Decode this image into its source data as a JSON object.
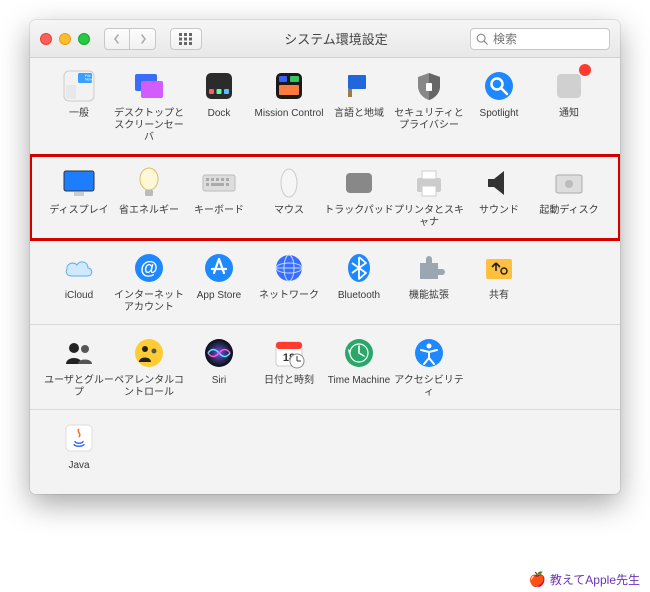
{
  "window": {
    "title": "システム環境設定"
  },
  "search": {
    "placeholder": "検索"
  },
  "rows": [
    {
      "items": [
        {
          "key": "general",
          "label": "一般"
        },
        {
          "key": "desktop-screensaver",
          "label": "デスクトップとスクリーンセーバ"
        },
        {
          "key": "dock",
          "label": "Dock"
        },
        {
          "key": "mission-control",
          "label": "Mission Control"
        },
        {
          "key": "language-region",
          "label": "言語と地域"
        },
        {
          "key": "security-privacy",
          "label": "セキュリティとプライバシー"
        },
        {
          "key": "spotlight",
          "label": "Spotlight"
        },
        {
          "key": "notifications",
          "label": "通知",
          "badge": true
        }
      ]
    },
    {
      "highlighted": true,
      "items": [
        {
          "key": "displays",
          "label": "ディスプレイ"
        },
        {
          "key": "energy-saver",
          "label": "省エネルギー"
        },
        {
          "key": "keyboard",
          "label": "キーボード"
        },
        {
          "key": "mouse",
          "label": "マウス"
        },
        {
          "key": "trackpad",
          "label": "トラックパッド"
        },
        {
          "key": "printers-scanners",
          "label": "プリンタとスキャナ"
        },
        {
          "key": "sound",
          "label": "サウンド"
        },
        {
          "key": "startup-disk",
          "label": "起動ディスク"
        }
      ]
    },
    {
      "items": [
        {
          "key": "icloud",
          "label": "iCloud"
        },
        {
          "key": "internet-accounts",
          "label": "インターネットアカウント"
        },
        {
          "key": "app-store",
          "label": "App Store"
        },
        {
          "key": "network",
          "label": "ネットワーク"
        },
        {
          "key": "bluetooth",
          "label": "Bluetooth"
        },
        {
          "key": "extensions",
          "label": "機能拡張"
        },
        {
          "key": "sharing",
          "label": "共有"
        }
      ]
    },
    {
      "items": [
        {
          "key": "users-groups",
          "label": "ユーザとグループ"
        },
        {
          "key": "parental-controls",
          "label": "ペアレンタルコントロール"
        },
        {
          "key": "siri",
          "label": "Siri"
        },
        {
          "key": "date-time",
          "label": "日付と時刻"
        },
        {
          "key": "time-machine",
          "label": "Time Machine"
        },
        {
          "key": "accessibility",
          "label": "アクセシビリティ"
        }
      ]
    },
    {
      "items": [
        {
          "key": "java",
          "label": "Java"
        }
      ]
    }
  ],
  "watermark": "教えてApple先生"
}
